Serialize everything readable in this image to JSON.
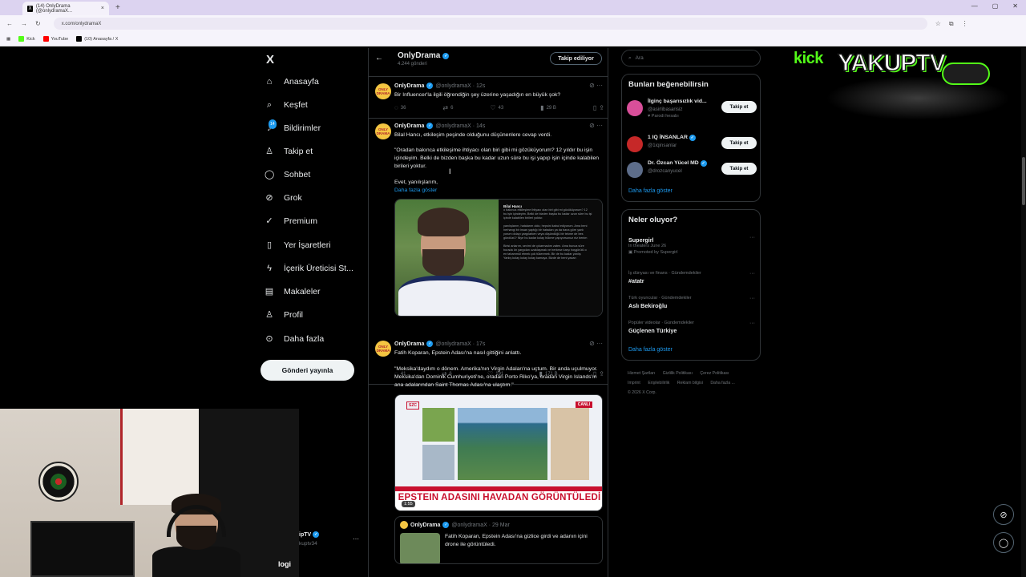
{
  "browser": {
    "tab_title": "(14) OnlyDrama (@onlydramaX...",
    "tab_close": "×",
    "new_tab": "+",
    "url": "x.com/onlydramaX",
    "bookmarks": [
      {
        "label": "Kick",
        "color": "#53fc18"
      },
      {
        "label": "YouTube",
        "color": "#ff0000"
      },
      {
        "label": "(10) Anasayfa / X",
        "color": "#000000"
      }
    ]
  },
  "nav": {
    "brand": "X",
    "items": [
      {
        "label": "Anasayfa",
        "icon": "home-icon",
        "glyph": "⌂"
      },
      {
        "label": "Keşfet",
        "icon": "search-icon",
        "glyph": "⌕"
      },
      {
        "label": "Bildirimler",
        "icon": "bell-icon",
        "glyph": "♪",
        "badge": "14"
      },
      {
        "label": "Takip et",
        "icon": "add-user-icon",
        "glyph": "♙"
      },
      {
        "label": "Sohbet",
        "icon": "chat-icon",
        "glyph": "◯"
      },
      {
        "label": "Grok",
        "icon": "grok-icon",
        "glyph": "⊘"
      },
      {
        "label": "Premium",
        "icon": "premium-icon",
        "glyph": "✓"
      },
      {
        "label": "Yer İşaretleri",
        "icon": "bookmark-icon",
        "glyph": "▯"
      },
      {
        "label": "İçerik Üreticisi St...",
        "icon": "bolt-icon",
        "glyph": "ϟ"
      },
      {
        "label": "Makaleler",
        "icon": "article-icon",
        "glyph": "▤"
      },
      {
        "label": "Profil",
        "icon": "profile-icon",
        "glyph": "♙"
      },
      {
        "label": "Daha fazla",
        "icon": "more-icon",
        "glyph": "⊙"
      }
    ],
    "post_button": "Gönderi yayınla"
  },
  "profile_header": {
    "name": "OnlyDrama",
    "posts_count": "4.244 gönderi",
    "following_button": "Takip ediliyor"
  },
  "tweets": [
    {
      "name": "OnlyDrama",
      "handle": "@onlydramaX · 12s",
      "text": "Bir Influencer'la ilgili öğrendiğin şey üzerine yaşadığın en büyük şok?",
      "replies": "36",
      "reposts": "6",
      "likes": "43",
      "views": "29 B"
    },
    {
      "name": "OnlyDrama",
      "handle": "@onlydramaX · 14s",
      "text": "Bilal Hancı, etkileşim peşinde olduğunu düşünenlere cevap verdi.",
      "quote": "\"Oradan bakınca etkileşime ihtiyacı olan biri gibi mi gözüküyorum? 12 yıldır bu işin içindeyim. Belki de bizden başka bu kadar uzun süre bu işi yapıp işin içinde kalabilen birileri yoktur.",
      "extra": "Evet, yanılışlarım,",
      "show_more": "Daha fazla göster",
      "media_screenshot": {
        "name": "Bilal Hancı",
        "lines": [
          "o bakınca etkileşime ihtiyacı olan biri gibi mi gözüküyorum? 12",
          "bu işin içindeyim. Belki de bizden başka bu kadar uzun süre bu işi",
          "içinde kalabilen birileri yoktur.",
          "",
          "yanılışlarım, hatalarım oldu; hepsini kabul ediyorum. Ama beni",
          "herhangi bir insan yaptığı bir hatadan ya da bana göre yanlı",
          "yorum dolayı yargılarken veya düşündüğü bir tekme de bes",
          "gündüzü? Niye bu kadar kolay hükme yapıyorsunuz niz benim",
          "",
          "Birisi anlarım, sevimi de çıkarmadım zaten. Ama bunca süre",
          "burada ön yargıdan uzaklaşmak ve herkese karşı hoşgörülü o",
          "en tahammül etmek çok tükenmek. Bir de bu kadar yanlış",
          "Yanlış kolay kolay kolay kamaya. Bizde de beni yazan"
        ]
      },
      "replies": "41",
      "reposts": "6",
      "likes": "191",
      "views": "171 B"
    },
    {
      "name": "OnlyDrama",
      "handle": "@onlydramaX · 17s",
      "text": "Fatih Koparan, Epstein Adası'na nasıl gittiğini anlattı.",
      "quote": "\"Meksika'daydım o dönem. Amerika'nın Virgin Adaları'na uçtum. Bir anda uçulmuyor. Meksika'dan Dominik Cumhuriyeti'ne, oradan Porto Riko'ya, oradan Virgin Islands'ın ana adalarından Saint Thomas Adası'na ulaştım.\"",
      "video": {
        "headline": "EPSTEIN ADASINI HAVADAN GÖRÜNTÜLEDİ",
        "live": "CANLI",
        "channel": "SZC",
        "duration": "1:55"
      },
      "quoted": {
        "name": "OnlyDrama",
        "handle": "@onlydramaX · 29 Mar",
        "text": "Fatih Koparan, Epstein Adası'na gizlice girdi ve adanın içini drone ile görüntüledi."
      }
    }
  ],
  "search": {
    "placeholder": "Ara"
  },
  "who_to_follow": {
    "title": "Bunları beğenebilirsin",
    "users": [
      {
        "name": "İlginç başarısızlık vid...",
        "handle": "@asirlibasarisiz",
        "sub": "Parodi hesabı",
        "button": "Takip et",
        "color": "#d94f9a"
      },
      {
        "name": "1 IQ İNSANLAR",
        "handle": "@1iqinsanlar",
        "sub": "",
        "button": "Takip et",
        "color": "#c62828"
      },
      {
        "name": "Dr. Özcan Yücel MD",
        "handle": "@drozcanyucel",
        "sub": "",
        "button": "Takip et",
        "color": "#5d6d8a"
      }
    ],
    "show_more": "Daha fazla göster"
  },
  "trends": {
    "title": "Neler oluyor?",
    "items": [
      {
        "context": "",
        "title": "Supergirl",
        "sub": "In theaters June 26",
        "promo": "Promoted by Supergirl"
      },
      {
        "context": "İş dünyası ve finans · Gündemdekiler",
        "title": "#atatr",
        "sub": "",
        "promo": ""
      },
      {
        "context": "Türk oyuncular · Gündemdekiler",
        "title": "Aslı Bekiroğlu",
        "sub": "",
        "promo": ""
      },
      {
        "context": "Popüler videolar · Gündemdekiler",
        "title": "Güçlenen Türkiye",
        "sub": "",
        "promo": ""
      }
    ],
    "show_more": "Daha fazla göster"
  },
  "footer": {
    "links": [
      "Hizmet Şartları",
      "Gizlilik Politikası",
      "Çerez Politikası",
      "Imprint",
      "Erişilebilirlik",
      "Reklam bilgisi",
      "Daha fazla ..."
    ],
    "copyright": "© 2026 X Corp."
  },
  "overlay": {
    "kick_logo": "kick",
    "channel_logo": "YAKUPTV",
    "cam_name": "ipTV",
    "cam_handle": "kuptv34",
    "cam_label": "logi"
  }
}
